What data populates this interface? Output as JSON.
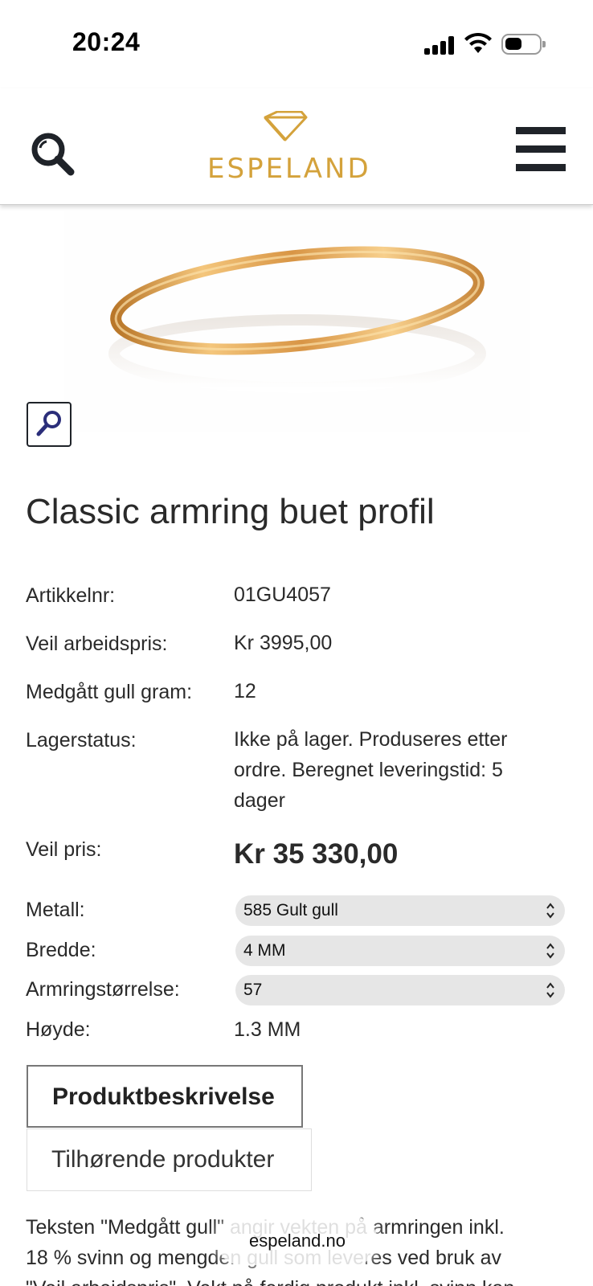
{
  "status_bar": {
    "time": "20:24"
  },
  "header": {
    "logo_text": "ESPELAND",
    "accent_color": "#d4a23b"
  },
  "product": {
    "title": "Classic armring buet profil",
    "details": [
      {
        "label": "Artikkelnr:",
        "value": "01GU4057"
      },
      {
        "label": "Veil arbeidspris:",
        "value": "Kr 3995,00"
      },
      {
        "label": "Medgått gull gram:",
        "value": "12"
      },
      {
        "label": "Lagerstatus:",
        "value_lines": [
          "Ikke på lager. Produseres etter",
          "ordre. Beregnet leveringstid: 5",
          "dager"
        ]
      },
      {
        "label": "Veil pris:",
        "value": "Kr 35 330,00"
      }
    ],
    "options": [
      {
        "label": "Metall:",
        "selected": "585 Gult gull"
      },
      {
        "label": "Bredde:",
        "selected": "4 MM"
      },
      {
        "label": "Armringstørrelse:",
        "selected": "57"
      }
    ],
    "height": {
      "label": "Høyde:",
      "value": "1.3 MM"
    }
  },
  "tabs": [
    {
      "label": "Produktbeskrivelse",
      "active": true
    },
    {
      "label": "Tilhørende produkter",
      "active": false
    }
  ],
  "description_lines": [
    "Teksten \"Medgått gull\" angir vekten på armringen inkl.",
    "18 % svinn og mengden gull som leveres ved bruk av",
    "\"Veil arbeidspris\". Vekt på ferdig produkt inkl. svinn kan"
  ],
  "browser": {
    "url": "espeland.no"
  }
}
